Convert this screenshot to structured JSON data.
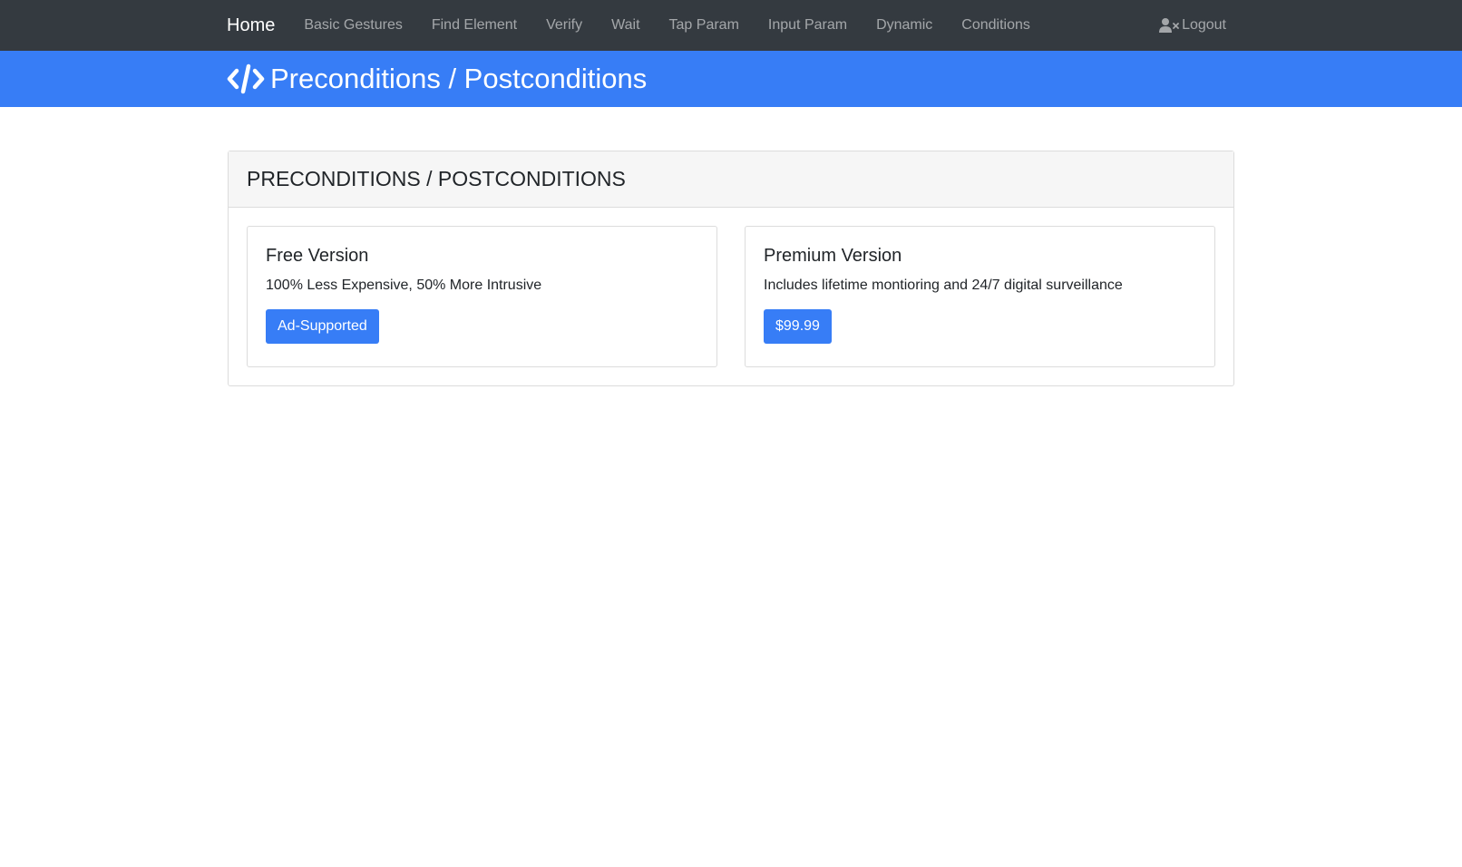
{
  "navbar": {
    "brand": "Home",
    "links": [
      "Basic Gestures",
      "Find Element",
      "Verify",
      "Wait",
      "Tap Param",
      "Input Param",
      "Dynamic",
      "Conditions"
    ],
    "logout_label": "Logout",
    "logout_icon": "user-times-icon"
  },
  "banner": {
    "icon": "code-icon",
    "title": "Preconditions / Postconditions"
  },
  "card": {
    "header": "PRECONDITIONS / POSTCONDITIONS",
    "free": {
      "title": "Free Version",
      "description": "100% Less Expensive, 50% More Intrusive",
      "button_label": "Ad-Supported"
    },
    "premium": {
      "title": "Premium Version",
      "description": "Includes lifetime montioring and 24/7 digital surveillance",
      "button_label": "$99.99"
    }
  },
  "colors": {
    "navbar_bg": "#343a40",
    "accent": "#377df6",
    "card_header_bg": "#f6f6f6"
  }
}
